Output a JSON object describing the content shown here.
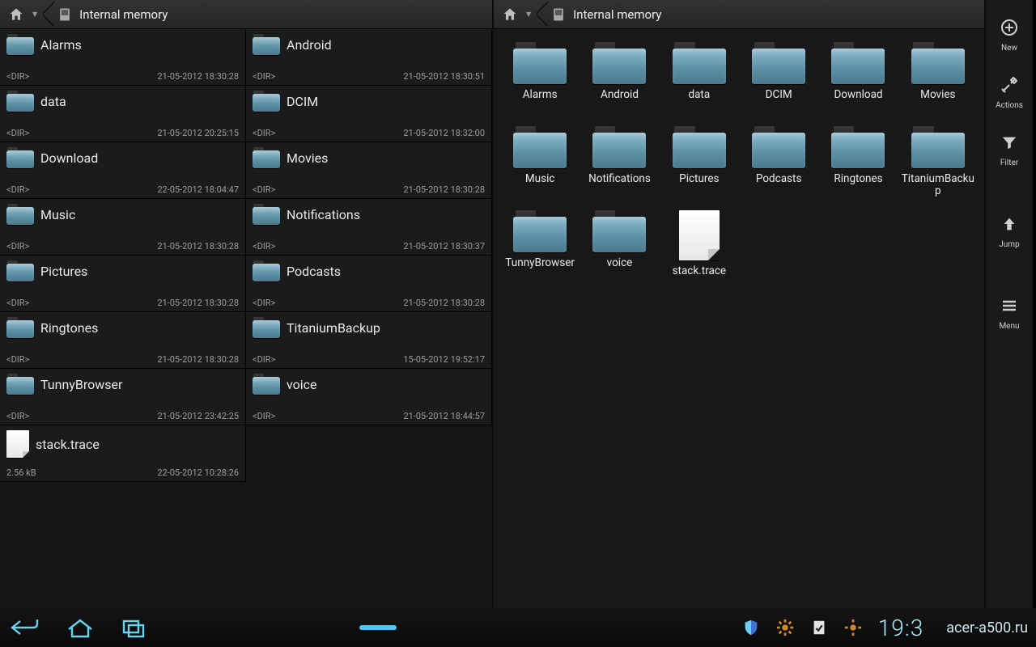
{
  "left_pane": {
    "breadcrumb": {
      "location": "Internal memory"
    },
    "items": [
      {
        "name": "Alarms",
        "kind": "dir",
        "size": "<DIR>",
        "date": "21-05-2012 18:30:28"
      },
      {
        "name": "Android",
        "kind": "dir",
        "size": "<DIR>",
        "date": "21-05-2012 18:30:51"
      },
      {
        "name": "data",
        "kind": "dir",
        "size": "<DIR>",
        "date": "21-05-2012 20:25:15"
      },
      {
        "name": "DCIM",
        "kind": "dir",
        "size": "<DIR>",
        "date": "21-05-2012 18:32:00"
      },
      {
        "name": "Download",
        "kind": "dir",
        "size": "<DIR>",
        "date": "22-05-2012 18:04:47"
      },
      {
        "name": "Movies",
        "kind": "dir",
        "size": "<DIR>",
        "date": "21-05-2012 18:30:28"
      },
      {
        "name": "Music",
        "kind": "dir",
        "size": "<DIR>",
        "date": "21-05-2012 18:30:28"
      },
      {
        "name": "Notifications",
        "kind": "dir",
        "size": "<DIR>",
        "date": "21-05-2012 18:30:37"
      },
      {
        "name": "Pictures",
        "kind": "dir",
        "size": "<DIR>",
        "date": "21-05-2012 18:30:28"
      },
      {
        "name": "Podcasts",
        "kind": "dir",
        "size": "<DIR>",
        "date": "21-05-2012 18:30:28"
      },
      {
        "name": "Ringtones",
        "kind": "dir",
        "size": "<DIR>",
        "date": "21-05-2012 18:30:28"
      },
      {
        "name": "TitaniumBackup",
        "kind": "dir",
        "size": "<DIR>",
        "date": "15-05-2012 19:52:17"
      },
      {
        "name": "TunnyBrowser",
        "kind": "dir",
        "size": "<DIR>",
        "date": "21-05-2012 23:42:25"
      },
      {
        "name": "voice",
        "kind": "dir",
        "size": "<DIR>",
        "date": "21-05-2012 18:44:57"
      },
      {
        "name": "stack.trace",
        "kind": "file",
        "size": "2.56 kB",
        "date": "22-05-2012 10:28:26"
      }
    ]
  },
  "right_pane": {
    "breadcrumb": {
      "location": "Internal memory"
    },
    "items": [
      {
        "name": "Alarms",
        "kind": "dir"
      },
      {
        "name": "Android",
        "kind": "dir"
      },
      {
        "name": "data",
        "kind": "dir"
      },
      {
        "name": "DCIM",
        "kind": "dir"
      },
      {
        "name": "Download",
        "kind": "dir"
      },
      {
        "name": "Movies",
        "kind": "dir"
      },
      {
        "name": "Music",
        "kind": "dir"
      },
      {
        "name": "Notifications",
        "kind": "dir"
      },
      {
        "name": "Pictures",
        "kind": "dir"
      },
      {
        "name": "Podcasts",
        "kind": "dir"
      },
      {
        "name": "Ringtones",
        "kind": "dir"
      },
      {
        "name": "TitaniumBackup",
        "kind": "dir"
      },
      {
        "name": "TunnyBrowser",
        "kind": "dir"
      },
      {
        "name": "voice",
        "kind": "dir"
      },
      {
        "name": "stack.trace",
        "kind": "file"
      }
    ]
  },
  "sidebar": {
    "tools": [
      {
        "id": "new",
        "label": "New",
        "icon": "plus-icon"
      },
      {
        "id": "actions",
        "label": "Actions",
        "icon": "tools-icon"
      },
      {
        "id": "filter",
        "label": "Filter",
        "icon": "filter-icon"
      },
      {
        "id": "jump",
        "label": "Jump",
        "icon": "up-icon"
      },
      {
        "id": "menu",
        "label": "Menu",
        "icon": "menu-icon"
      }
    ]
  },
  "sysbar": {
    "clock": "19:3",
    "watermark": "acer-a500.ru"
  }
}
